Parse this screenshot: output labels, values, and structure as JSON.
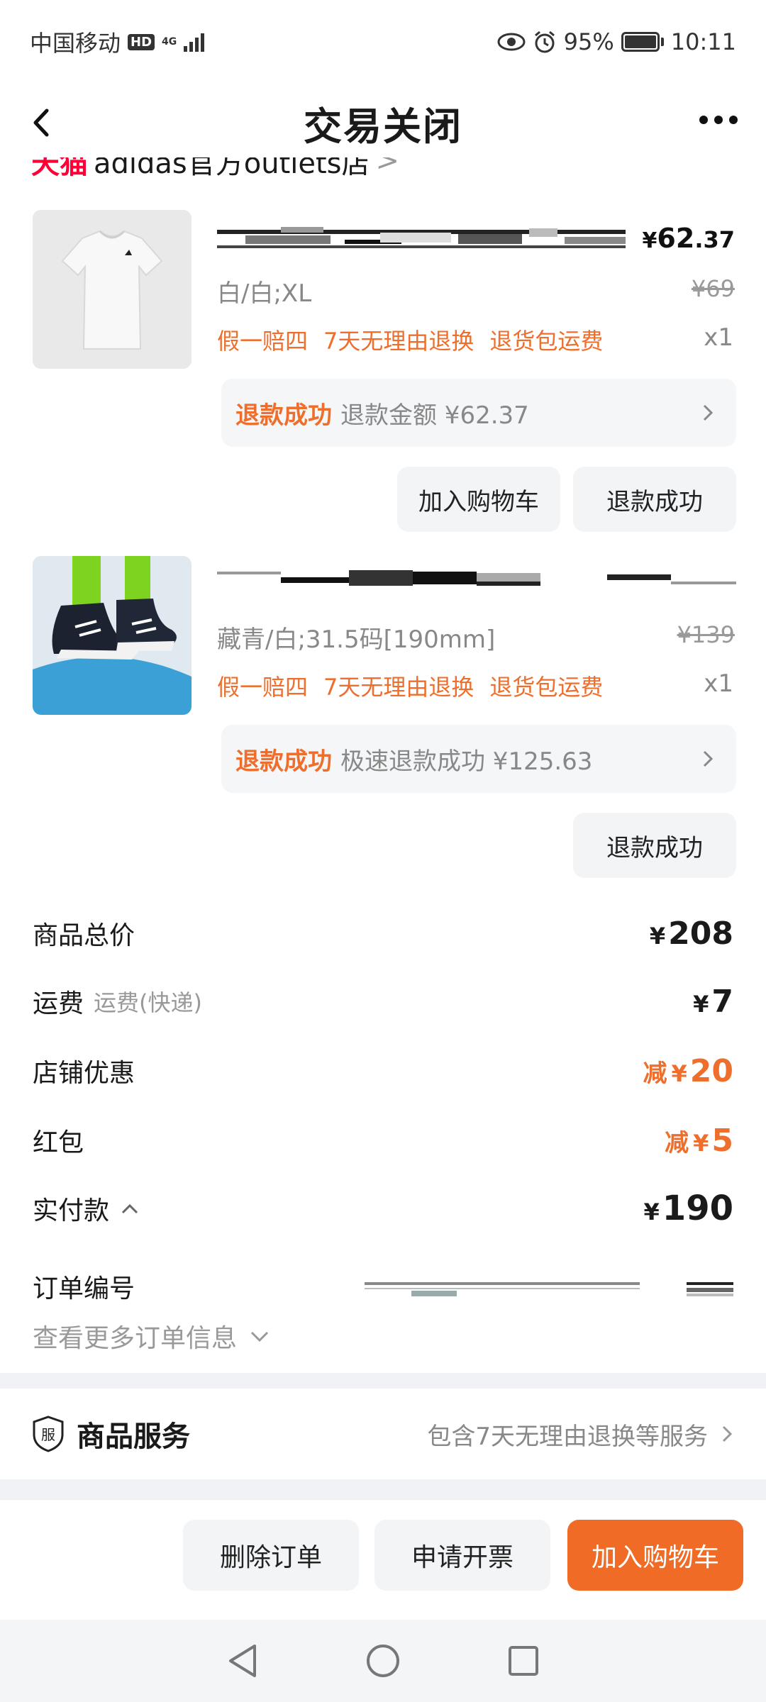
{
  "status_bar": {
    "carrier": "中国移动",
    "hd": "HD",
    "network": "4G",
    "battery": "95%",
    "time": "10:11"
  },
  "header": {
    "title": "交易关闭",
    "back_icon": "chevron-left-icon",
    "more_icon": "more-dots-icon"
  },
  "shop": {
    "platform": "天猫",
    "name": "adidas官方outlets店"
  },
  "items": [
    {
      "title": "",
      "price_int": "62",
      "price_dec": ".37",
      "currency": "¥",
      "spec": "白/白;XL",
      "orig_price": "¥69",
      "tags": [
        "假一赔四",
        "7天无理由退换",
        "退货包运费"
      ],
      "qty": "x1",
      "refund_status": "退款成功",
      "refund_detail": "退款金额 ¥62.37",
      "buttons": [
        "加入购物车",
        "退款成功"
      ]
    },
    {
      "title": "",
      "spec": "藏青/白;31.5码[190mm]",
      "orig_price": "¥139",
      "tags": [
        "假一赔四",
        "7天无理由退换",
        "退货包运费"
      ],
      "qty": "x1",
      "refund_status": "退款成功",
      "refund_detail": "极速退款成功 ¥125.63",
      "buttons": [
        "退款成功"
      ]
    }
  ],
  "summary": {
    "currency": "¥",
    "goods_total_label": "商品总价",
    "goods_total": "208",
    "shipping_label": "运费",
    "shipping_sub": "运费(快递)",
    "shipping": "7",
    "shop_discount_label": "店铺优惠",
    "shop_discount_prefix": "减",
    "shop_discount": "20",
    "red_packet_label": "红包",
    "red_packet_prefix": "减",
    "red_packet": "5",
    "paid_label": "实付款",
    "paid": "190",
    "order_no_label": "订单编号",
    "view_more": "查看更多订单信息"
  },
  "service": {
    "icon_text": "服",
    "title": "商品服务",
    "desc": "包含7天无理由退换等服务"
  },
  "actions": {
    "delete": "删除订单",
    "invoice": "申请开票",
    "add_cart": "加入购物车"
  },
  "colors": {
    "accent": "#ee6f2d",
    "button_orange": "#f06b25",
    "tmall_red": "#ff0036"
  }
}
